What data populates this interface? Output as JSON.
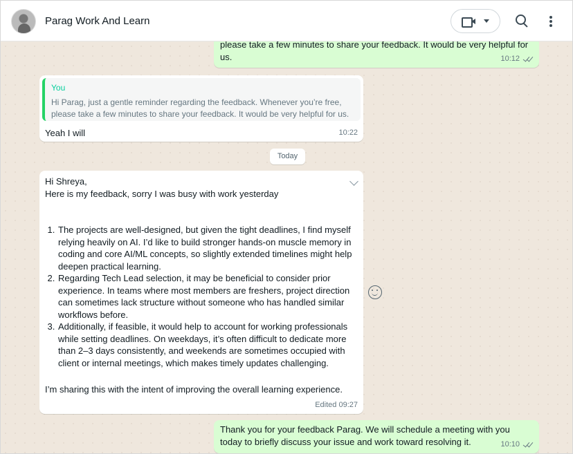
{
  "header": {
    "contact_name": "Parag Work And Learn"
  },
  "messages": {
    "m1": {
      "text": "please take a few minutes to share your feedback. It would be very helpful for us.",
      "time": "10:12"
    },
    "m2": {
      "quote_author": "You",
      "quote_text": "Hi Parag, just a gentle reminder regarding the feedback. Whenever you’re free, please take a few minutes to share your feedback. It would be very helpful for us.",
      "text": "Yeah I will",
      "time": "10:22"
    },
    "date_divider": "Today",
    "m3": {
      "greeting": "Hi Shreya,",
      "intro": "Here is my feedback, sorry I was busy with work yesterday",
      "points": [
        "The projects are well-designed, but given the tight deadlines, I find myself relying heavily on AI. I’d like to build stronger hands-on muscle memory in coding and core AI/ML concepts, so slightly extended timelines might help deepen practical learning.",
        "Regarding Tech Lead selection, it may be beneficial to consider prior experience. In teams where most members are freshers, project direction can sometimes lack structure without someone who has handled similar workflows before.",
        "Additionally, if feasible, it would help to account for working professionals while setting deadlines. On weekdays, it’s often difficult to dedicate more than 2–3 days consistently, and weekends are sometimes occupied with client or internal meetings, which makes timely updates challenging."
      ],
      "closing": "I’m sharing this with the intent of improving the overall learning experience.",
      "time": "Edited 09:27"
    },
    "m4": {
      "text": "Thank you for your feedback Parag. We will schedule a meeting with you today to briefly discuss your issue and work toward resolving it.",
      "time": "10:10"
    }
  }
}
